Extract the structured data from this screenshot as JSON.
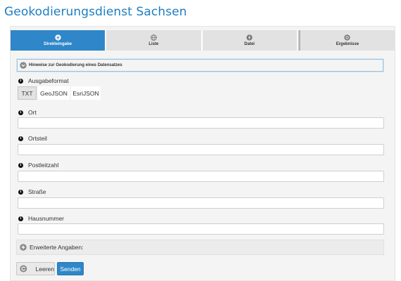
{
  "page": {
    "title": "Geokodierungsdienst Sachsen"
  },
  "tabs": [
    {
      "label": "Direkteingabe",
      "icon": "list-icon",
      "active": true
    },
    {
      "label": "Liste",
      "icon": "globe-icon",
      "active": false
    },
    {
      "label": "Datei",
      "icon": "upload-icon",
      "active": false
    },
    {
      "label": "Ergebnisse",
      "icon": "dot-circle-icon",
      "active": false
    }
  ],
  "hint": {
    "label": "Hinweise zur Geokodierung eines Datensatzes",
    "icon": "chevron-circle-down-icon"
  },
  "output_format": {
    "label": "Ausgabeformat",
    "options": [
      "TXT",
      "GeoJSON",
      "EsriJSON"
    ],
    "selected": "TXT"
  },
  "fields": [
    {
      "label": "Ort",
      "value": ""
    },
    {
      "label": "Ortsteil",
      "value": ""
    },
    {
      "label": "Postleitzahl",
      "value": ""
    },
    {
      "label": "Straße",
      "value": ""
    },
    {
      "label": "Hausnummer",
      "value": ""
    }
  ],
  "extended": {
    "label": "Erweiterte Angaben:",
    "icon": "plus-circle-icon"
  },
  "buttons": {
    "clear_label": "Leeren",
    "clear_icon": "reset-icon",
    "send_label": "Senden"
  },
  "info_icon": "info-icon",
  "colors": {
    "accent": "#2f86c8",
    "title": "#1d7ec3"
  }
}
